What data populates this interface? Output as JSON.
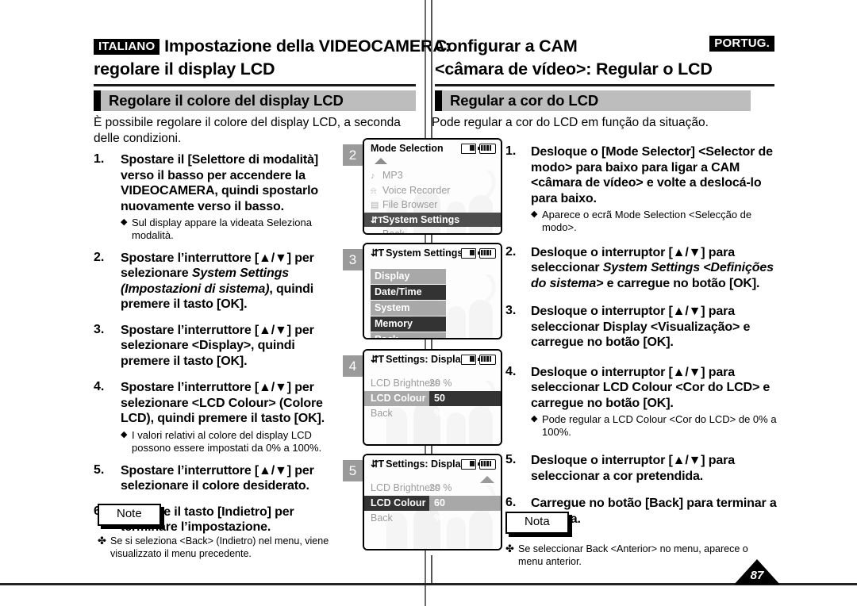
{
  "header": {
    "left": {
      "badge": "ITALIANO",
      "line1": "Impostazione della VIDEOCAMERA:",
      "line2": "regolare il display LCD",
      "section": "Regolare il colore del display LCD"
    },
    "right": {
      "badge": "PORTUG.",
      "line1": "Configurar a CAM",
      "line2": "<câmara de vídeo>: Regular o LCD",
      "section": "Regular a cor do LCD"
    }
  },
  "left": {
    "intro": "È possibile regolare il colore del display LCD, a seconda delle condizioni.",
    "steps": [
      {
        "num": "1.",
        "text": "Spostare il [Selettore di modalità] verso il basso per accendere la VIDEOCAMERA, quindi spostarlo nuovamente verso il basso.",
        "sub": "Sul display appare la videata Seleziona modalità."
      },
      {
        "num": "2.",
        "text_a": "Spostare l’interruttore [▲/▼] per selezionare ",
        "text_i": "System Settings (Impostazioni di sistema)",
        "text_b": ", quindi premere il tasto [OK].",
        "sub": ""
      },
      {
        "num": "3.",
        "text": "Spostare l’interruttore [▲/▼] per selezionare <Display>, quindi premere il tasto [OK].",
        "sub": ""
      },
      {
        "num": "4.",
        "text": "Spostare l’interruttore [▲/▼] per selezionare <LCD Colour> (Colore LCD), quindi premere il tasto [OK].",
        "sub": "I valori relativi al colore del display LCD possono essere impostati da 0% a 100%."
      },
      {
        "num": "5.",
        "text": "Spostare l’interruttore [▲/▼] per selezionare il colore desiderato.",
        "sub": ""
      },
      {
        "num": "6.",
        "text": "Premere il tasto [Indietro] per terminare l’impostazione.",
        "sub": ""
      }
    ],
    "note": {
      "label": "Note",
      "item": "Se si seleziona <Back> (Indietro) nel menu, viene visualizzato il menu precedente."
    }
  },
  "right": {
    "intro": "Pode regular a cor do LCD em função da situação.",
    "steps": [
      {
        "num": "1.",
        "text": "Desloque o [Mode Selector] <Selector de modo> para baixo para ligar a CAM <câmara de vídeo> e volte a deslocá-lo para baixo.",
        "sub": "Aparece o ecrã Mode Selection <Selecção de modo>."
      },
      {
        "num": "2.",
        "text_a": "Desloque o interruptor [▲/▼] para seleccionar ",
        "text_i": "System Settings <Definições do sistema>",
        "text_b": " e carregue no botão [OK].",
        "sub": ""
      },
      {
        "num": "3.",
        "text": "Desloque o interruptor [▲/▼] para seleccionar Display <Visualização> e carregue no botão [OK].",
        "sub": ""
      },
      {
        "num": "4.",
        "text": "Desloque o interruptor [▲/▼] para seleccionar LCD Colour <Cor do LCD> e carregue no botão [OK].",
        "sub": "Pode regular a LCD Colour <Cor do LCD> de 0% a 100%."
      },
      {
        "num": "5.",
        "text": "Desloque o interruptor [▲/▼] para seleccionar a cor pretendida.",
        "sub": ""
      },
      {
        "num": "6.",
        "text": "Carregue no botão [Back] para terminar a escolha.",
        "sub": ""
      }
    ],
    "note": {
      "label": "Nota",
      "item": "Se seleccionar Back <Anterior> no menu, aparece o menu anterior."
    }
  },
  "screens": [
    {
      "step": "2",
      "title": "Mode Selection",
      "title_icon": "",
      "kind": "list",
      "has_up_arrow": true,
      "rows": [
        {
          "icon": "♪",
          "label": "MP3",
          "selected": false
        },
        {
          "icon": "♉",
          "label": "Voice Recorder",
          "selected": false
        },
        {
          "icon": "▤",
          "label": "File Browser",
          "selected": false
        },
        {
          "icon": "⇅T",
          "label": "System Settings",
          "selected": true
        },
        {
          "icon": "",
          "label": "Back",
          "selected": false
        }
      ]
    },
    {
      "step": "3",
      "title": "System Settings",
      "title_icon": "⇅T",
      "kind": "blocks",
      "rows": [
        {
          "label": "Display",
          "style": "g"
        },
        {
          "label": "Date/Time",
          "style": "d"
        },
        {
          "label": "System",
          "style": "g"
        },
        {
          "label": "Memory",
          "style": "d"
        },
        {
          "label": "Back",
          "style": "g"
        }
      ]
    },
    {
      "step": "4",
      "title": "Settings: Display",
      "title_icon": "⇅T",
      "kind": "settings",
      "scroll": false,
      "rows": [
        {
          "label": "LCD Brightness",
          "value": "20 %",
          "selected": false
        },
        {
          "label": "LCD Colour",
          "value": "50 %",
          "selected": true
        },
        {
          "label": "Back",
          "value": "",
          "selected": false
        }
      ]
    },
    {
      "step": "5",
      "title": "Settings: Display",
      "title_icon": "⇅T",
      "kind": "settings",
      "scroll": true,
      "rows": [
        {
          "label": "LCD Brightness",
          "value": "20 %",
          "selected": false
        },
        {
          "label": "LCD Colour",
          "value": "60 %",
          "selected": true
        },
        {
          "label": "Back",
          "value": "",
          "selected": false
        }
      ]
    }
  ],
  "page_number": "87"
}
